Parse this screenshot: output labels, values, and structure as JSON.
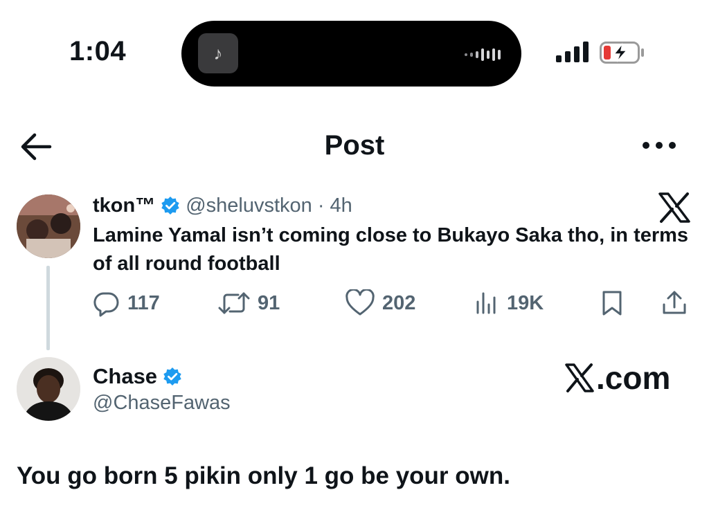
{
  "status_bar": {
    "time": "1:04",
    "island_app_glyph": "♪",
    "colors": {
      "battery_low": "#e53935",
      "island": "#000000"
    }
  },
  "header": {
    "title": "Post",
    "back_icon": "arrow-left-icon",
    "more_icon": "more-horizontal-icon"
  },
  "post": {
    "author_name": "tkon™",
    "verified": true,
    "handle": "@sheluvstkon",
    "separator": "·",
    "time_ago": "4h",
    "text": "Lamine Yamal isn’t coming close to Bukayo Saka tho, in terms of all round football",
    "stats": {
      "replies": "117",
      "reposts": "91",
      "likes": "202",
      "views": "19K"
    }
  },
  "reply_author": {
    "name": "Chase",
    "verified": true,
    "handle": "@ChaseFawas"
  },
  "watermark": {
    "domain_suffix": ".com"
  },
  "reply_text": "You go born 5 pikin only 1 go be your own.",
  "colors": {
    "verified_blue": "#1d9bf0",
    "muted": "#536471",
    "text": "#0f1419"
  }
}
